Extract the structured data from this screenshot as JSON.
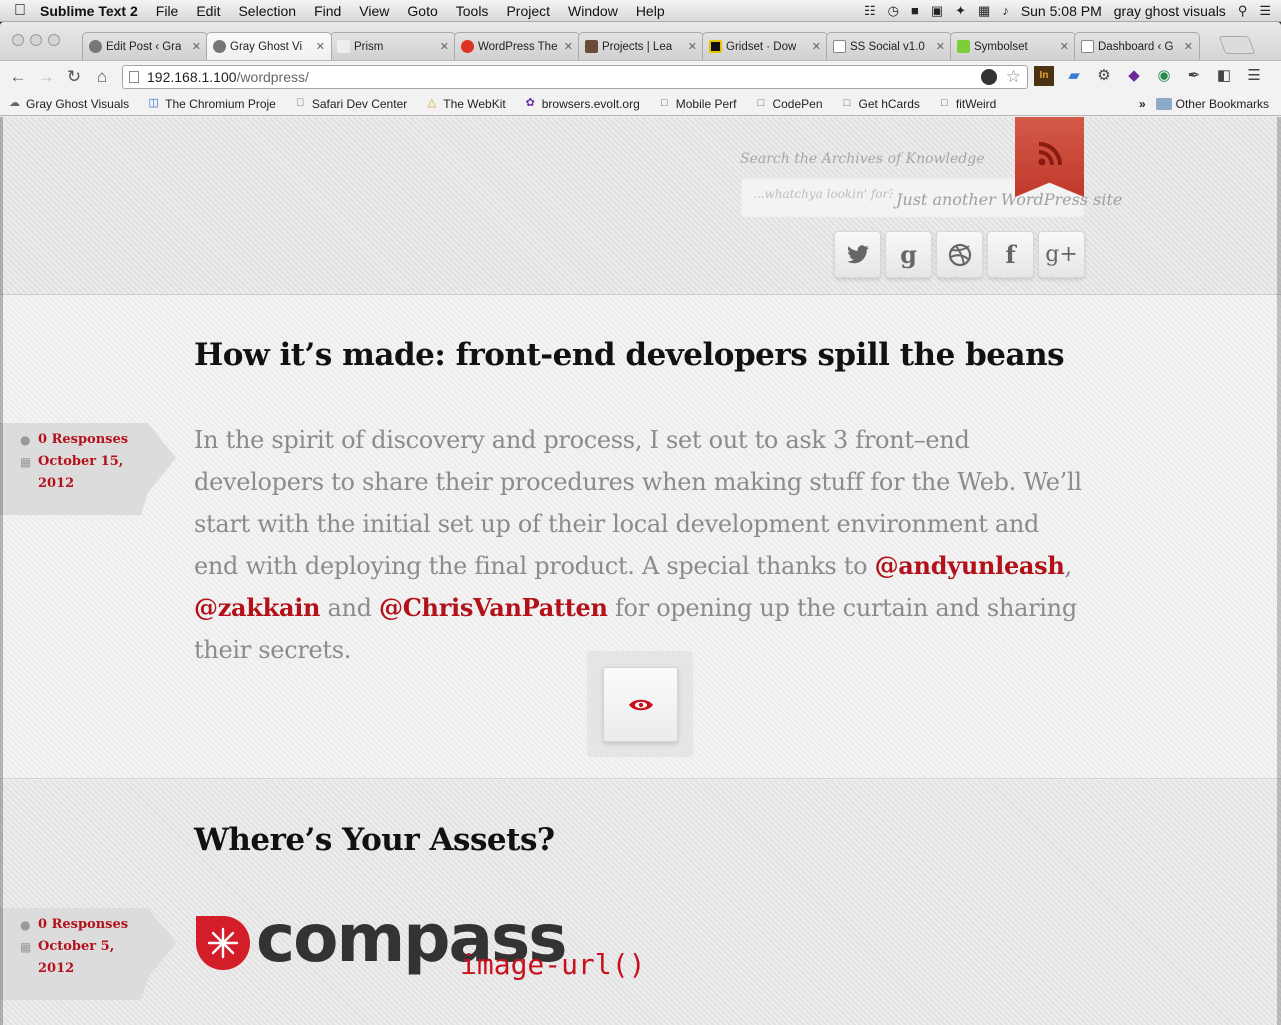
{
  "menubar": {
    "app_name": "Sublime Text 2",
    "items": [
      "File",
      "Edit",
      "Selection",
      "Find",
      "View",
      "Goto",
      "Tools",
      "Project",
      "Window",
      "Help"
    ],
    "clock": "Sun 5:08 PM",
    "user": "gray ghost visuals",
    "icons": [
      "wifi-icon",
      "time-machine-icon",
      "lock-icon",
      "display-icon",
      "bluetooth-icon",
      "keyboard-icon",
      "volume-icon",
      "spotlight-icon",
      "notification-list-icon"
    ]
  },
  "tabs": [
    {
      "label": "Edit Post ‹ Gra",
      "active": false
    },
    {
      "label": "Gray Ghost Vi",
      "active": true
    },
    {
      "label": "Prism",
      "active": false
    },
    {
      "label": "WordPress The",
      "active": false
    },
    {
      "label": "Projects | Lea",
      "active": false
    },
    {
      "label": "Gridset · Dow",
      "active": false
    },
    {
      "label": "SS Social v1.0",
      "active": false
    },
    {
      "label": "Symbolset",
      "active": false
    },
    {
      "label": "Dashboard ‹ G",
      "active": false
    }
  ],
  "omnibox": {
    "host": "192.168.1.100",
    "path": "/wordpress/"
  },
  "bookmarks": [
    {
      "label": "Gray Ghost Visuals"
    },
    {
      "label": "The Chromium Proje"
    },
    {
      "label": "Safari Dev Center"
    },
    {
      "label": "The WebKit"
    },
    {
      "label": "browsers.evolt.org"
    },
    {
      "label": "Mobile Perf"
    },
    {
      "label": "CodePen"
    },
    {
      "label": "Get hCards"
    },
    {
      "label": "fitWeird"
    }
  ],
  "bookmarks_more": "»",
  "bookmarks_other": "Other Bookmarks",
  "header": {
    "search_label": "Search the Archives of Knowledge",
    "search_placeholder": "...whatchya lookin' for?",
    "tagline": "Just another WordPress site",
    "social": [
      "twitter-icon",
      "gowalla-icon",
      "dribbble-icon",
      "facebook-icon",
      "google-plus-icon"
    ],
    "social_glyphs": [
      "🐦",
      "g",
      "◎",
      "f",
      "g+"
    ]
  },
  "posts": [
    {
      "title": "How it’s made: front-end developers spill the beans",
      "responses": "0 Responses",
      "date": "October 15, 2012",
      "excerpt_before": "In the spirit of discovery and process, I set out to ask 3 front–end developers to share their procedures when making stuff for the Web. We’ll start with the initial set up of their local development environment and end with deploying the final product. A special thanks to ",
      "link1": "@andyunleash",
      "sep1": ", ",
      "link2": "@zakkain",
      "sep2": " and ",
      "link3": "@ChrisVanPatten",
      "excerpt_after": " for opening up the curtain and sharing their secrets."
    },
    {
      "title": "Where’s Your Assets?",
      "responses": "0 Responses",
      "date": "October 5, 2012",
      "logo_word": "compass",
      "logo_sub": "image-url()"
    }
  ],
  "colors": {
    "accent": "#b3111a",
    "rss": "#c0392b"
  }
}
